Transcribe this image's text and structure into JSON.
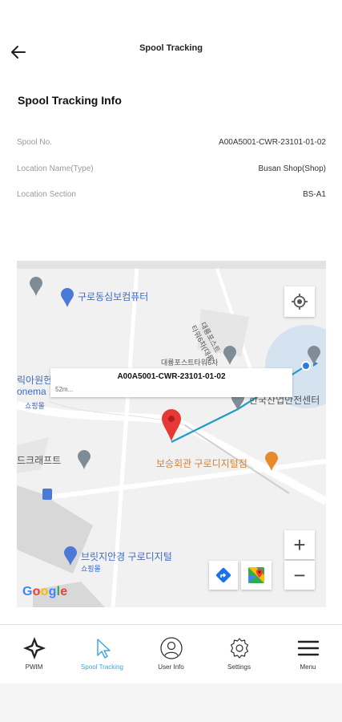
{
  "header": {
    "title": "Spool Tracking"
  },
  "section_title": "Spool Tracking Info",
  "info": [
    {
      "label": "Spool No.",
      "value": "A00A5001-CWR-23101-01-02"
    },
    {
      "label": "Location Name(Type)",
      "value": "Busan Shop(Shop)"
    },
    {
      "label": "Location Section",
      "value": "BS-A1"
    }
  ],
  "map": {
    "labels": {
      "poi_1": "구로동심보컴퓨터",
      "poi_2_line1": "대륭포스트",
      "poi_2_line2": "타워6차(대륭",
      "poi_3": "대륭포스트타워6차",
      "poi_4": "한국산업안전센터",
      "poi_5_line1": "릭아원헌",
      "poi_5_line2": "onema",
      "poi_5_line3": "쇼핑몰",
      "poi_6": "드크래프트",
      "poi_7": "보승회관 구로디지털점",
      "poi_8": "브릿지안경 구로디지털",
      "poi_8_sub": "쇼핑몰"
    },
    "callout": {
      "title": "A00A5001-CWR-23101-01-02",
      "distance": "52m..."
    },
    "zoom_in": "+",
    "zoom_out": "−",
    "logo": "Google"
  },
  "icons": {
    "back": "arrow-left-icon",
    "locate": "crosshair-icon",
    "directions": "directions-icon",
    "gmaps": "google-maps-icon",
    "marker": "map-marker-icon"
  },
  "colors": {
    "active_nav": "#3aa3e0",
    "route_line": "#1e9bc7",
    "marker_red": "#e53935",
    "poi_blue": "#4a79d8",
    "poi_orange": "#e8892b"
  },
  "nav": [
    {
      "label": "PWIM",
      "icon": "pwim-logo-icon"
    },
    {
      "label": "Spool Tracking",
      "icon": "cursor-icon",
      "active": true
    },
    {
      "label": "User Info",
      "icon": "user-icon"
    },
    {
      "label": "Settings",
      "icon": "gear-icon"
    },
    {
      "label": "Menu",
      "icon": "menu-icon"
    }
  ]
}
